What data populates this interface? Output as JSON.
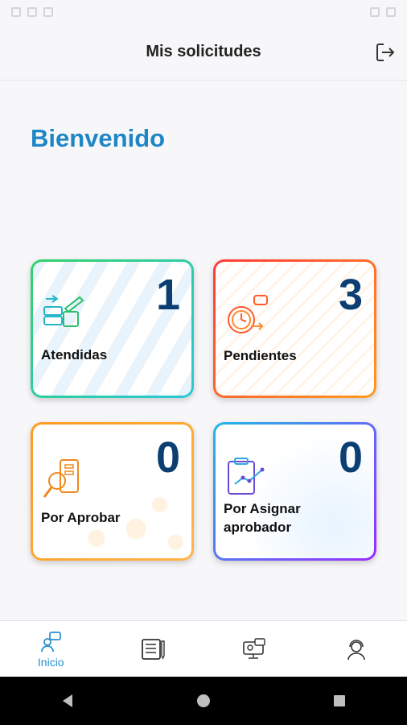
{
  "header": {
    "title": "Mis solicitudes"
  },
  "welcome": "Bienvenido",
  "cards": [
    {
      "label": "Atendidas",
      "count": "1",
      "icon": "attended-icon"
    },
    {
      "label": "Pendientes",
      "count": "3",
      "icon": "pending-icon"
    },
    {
      "label": "Por Aprobar",
      "count": "0",
      "icon": "approve-icon"
    },
    {
      "label_line1": "Por Asignar",
      "label_line2": "aprobador",
      "count": "0",
      "icon": "assign-approver-icon"
    }
  ],
  "nav": {
    "items": [
      {
        "label": "Inicio",
        "icon": "home-icon",
        "active": true
      },
      {
        "icon": "requests-list-icon"
      },
      {
        "icon": "monitor-icon"
      },
      {
        "icon": "support-agent-icon"
      }
    ]
  },
  "colors": {
    "accent": "#1f86c6",
    "count": "#0c3e72"
  }
}
